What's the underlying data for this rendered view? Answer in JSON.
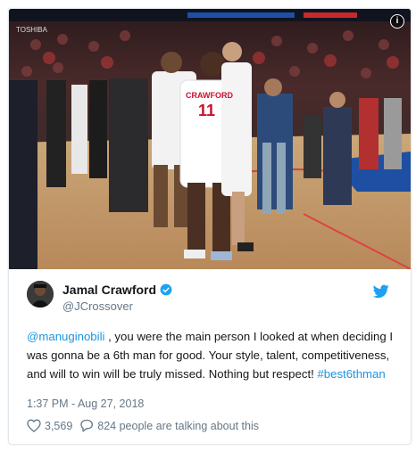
{
  "author": {
    "display_name": "Jamal Crawford",
    "handle": "@JCrossover"
  },
  "media": {
    "jersey_left": "CRAWFORD",
    "jersey_number": "11",
    "arena_banner": "TOSHIBA"
  },
  "tweet": {
    "mention": "@manuginobili",
    "text_main": " , you were the main person I looked at when deciding I was gonna be a 6th man for good. Your style, talent, competitiveness, and will to win will be truly missed. Nothing but respect! ",
    "hashtag": "#best6thman"
  },
  "timestamp": "1:37 PM - Aug 27, 2018",
  "actions": {
    "likes": "3,569",
    "talking": "824 people are talking about this"
  },
  "colors": {
    "link": "#1b95e0",
    "muted": "#657786",
    "verified": "#1da1f2"
  },
  "icons": [
    "info-icon",
    "verified-icon",
    "twitter-bird-icon",
    "heart-icon",
    "comment-icon"
  ]
}
